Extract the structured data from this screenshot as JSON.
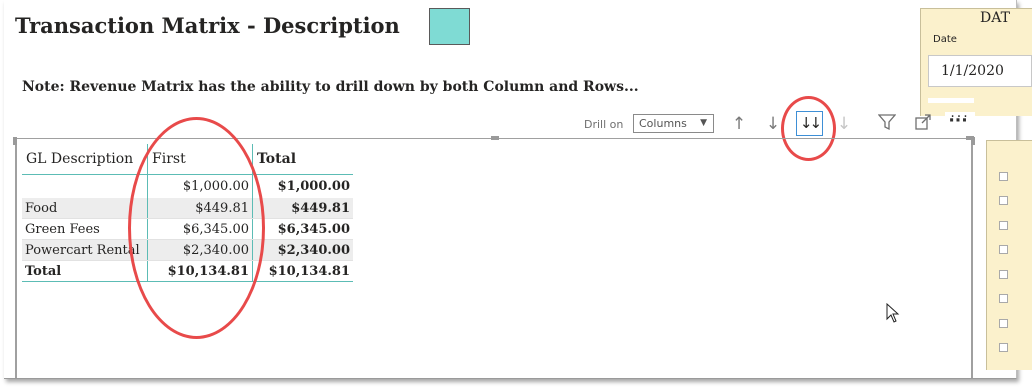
{
  "page": {
    "title": "Transaction Matrix - Description",
    "note": "Note: Revenue Matrix has the ability to drill down by both Column and Rows...",
    "swatch_color": "#7fdbd4"
  },
  "date_slicer": {
    "title": "DAT",
    "label": "Date",
    "value": "1/1/2020"
  },
  "toolbar": {
    "drill_on_label": "Drill on",
    "drill_select_value": "Columns",
    "icons": [
      "drill-up-icon",
      "drill-down-icon",
      "expand-next-level-icon",
      "go-to-next-level-icon",
      "filter-icon",
      "focus-mode-icon",
      "more-options-icon"
    ]
  },
  "matrix": {
    "headers": [
      "GL Description",
      "First",
      "Total"
    ],
    "rows": [
      {
        "label": "",
        "first": "$1,000.00",
        "total": "$1,000.00"
      },
      {
        "label": "Food",
        "first": "$449.81",
        "total": "$449.81"
      },
      {
        "label": "Green Fees",
        "first": "$6,345.00",
        "total": "$6,345.00"
      },
      {
        "label": "Powercart Rental",
        "first": "$2,340.00",
        "total": "$2,340.00"
      }
    ],
    "total_row": {
      "label": "Total",
      "first": "$10,134.81",
      "total": "$10,134.81"
    }
  },
  "annotations": {
    "highlight_color": "#e84a4a"
  }
}
